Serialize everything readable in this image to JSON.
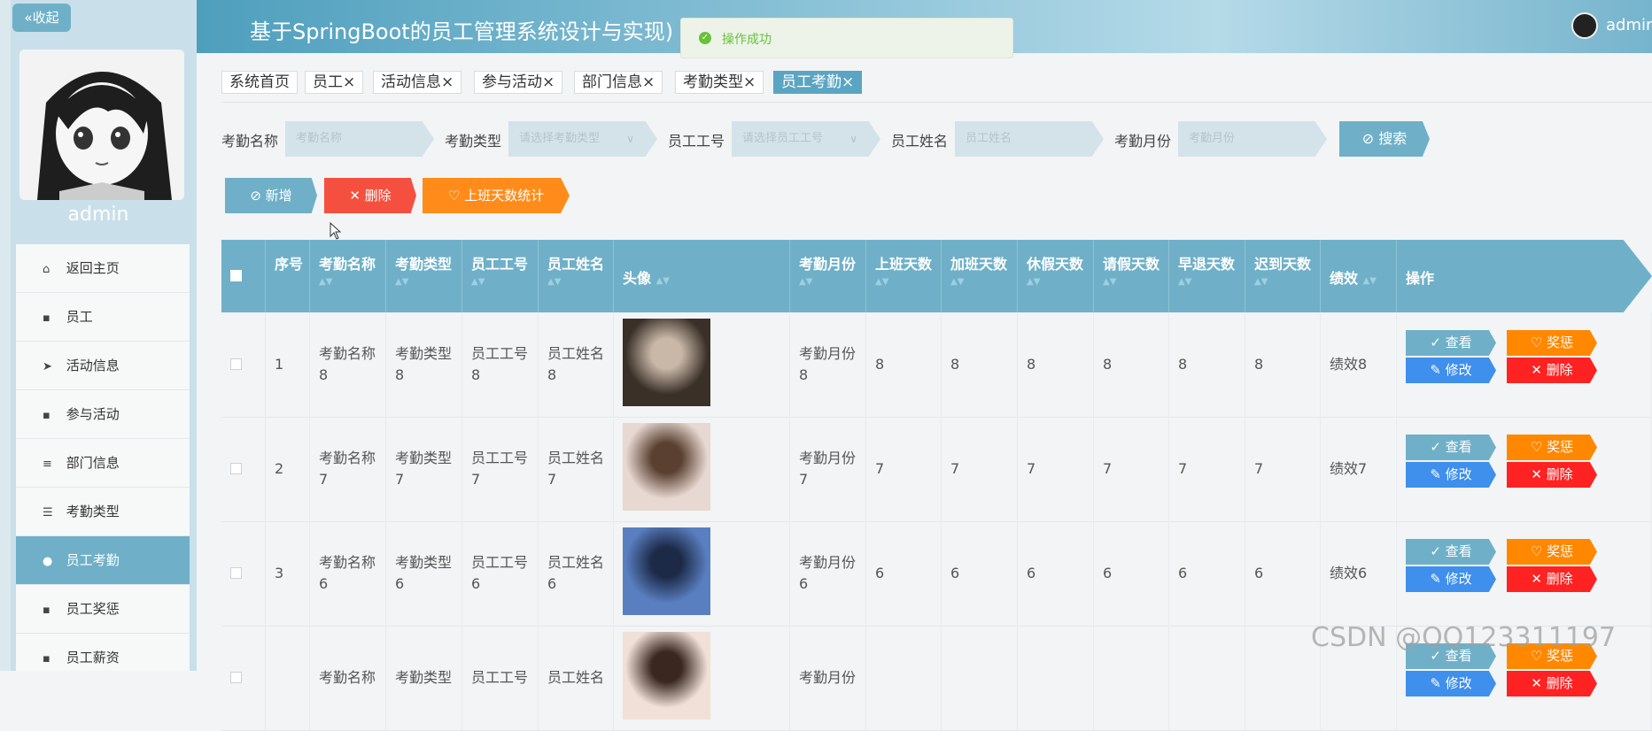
{
  "sidebar": {
    "collapse_label": "«收起",
    "username": "admin",
    "menu": [
      {
        "label": "返回主页",
        "icon": "home-icon",
        "glyph": "⌂",
        "active": false
      },
      {
        "label": "员工",
        "icon": "grid-icon",
        "glyph": "▪",
        "active": false
      },
      {
        "label": "活动信息",
        "icon": "send-icon",
        "glyph": "➤",
        "active": false
      },
      {
        "label": "参与活动",
        "icon": "grid-icon",
        "glyph": "▪",
        "active": false
      },
      {
        "label": "部门信息",
        "icon": "sliders-icon",
        "glyph": "≡",
        "active": false
      },
      {
        "label": "考勤类型",
        "icon": "list-icon",
        "glyph": "☰",
        "active": false
      },
      {
        "label": "员工考勤",
        "icon": "user-icon",
        "glyph": "●",
        "active": true
      },
      {
        "label": "员工奖惩",
        "icon": "grid-icon",
        "glyph": "▪",
        "active": false
      },
      {
        "label": "员工薪资",
        "icon": "grid-icon",
        "glyph": "▪",
        "active": false
      }
    ]
  },
  "header": {
    "title": "基于SpringBoot的员工管理系统设计与实现)",
    "user": "admin"
  },
  "toast": {
    "text": "操作成功",
    "icon": "check-circle-icon"
  },
  "tabs": [
    {
      "label": "系统首页",
      "closable": false
    },
    {
      "label": "员工×",
      "closable": true
    },
    {
      "label": "活动信息×",
      "closable": true
    },
    {
      "label": "参与活动×",
      "closable": true
    },
    {
      "label": "部门信息×",
      "closable": true
    },
    {
      "label": "考勤类型×",
      "closable": true
    },
    {
      "label": "员工考勤×",
      "closable": true,
      "active": true
    }
  ],
  "search": {
    "fields": [
      {
        "label": "考勤名称",
        "placeholder": "考勤名称",
        "dropdown": false
      },
      {
        "label": "考勤类型",
        "placeholder": "请选择考勤类型",
        "dropdown": true
      },
      {
        "label": "员工工号",
        "placeholder": "请选择员工工号",
        "dropdown": true
      },
      {
        "label": "员工姓名",
        "placeholder": "员工姓名",
        "dropdown": false
      },
      {
        "label": "考勤月份",
        "placeholder": "考勤月份",
        "dropdown": false
      }
    ],
    "button": "搜索"
  },
  "actions": {
    "add": "新增",
    "delete": "删除",
    "stats": "上班天数统计"
  },
  "table": {
    "headers": [
      "序号",
      "考勤名称",
      "考勤类型",
      "员工工号",
      "员工姓名",
      "头像",
      "考勤月份",
      "上班天数",
      "加班天数",
      "休假天数",
      "请假天数",
      "早退天数",
      "迟到天数",
      "绩效",
      "操作"
    ],
    "rows": [
      {
        "no": "1",
        "name": "考勤名称8",
        "type": "考勤类型8",
        "emp_no": "员工工号8",
        "emp_name": "员工姓名8",
        "month": "考勤月份8",
        "work": "8",
        "overtime": "8",
        "vacation": "8",
        "leave": "8",
        "early": "8",
        "late": "8",
        "perf": "绩效8"
      },
      {
        "no": "2",
        "name": "考勤名称7",
        "type": "考勤类型7",
        "emp_no": "员工工号7",
        "emp_name": "员工姓名7",
        "month": "考勤月份7",
        "work": "7",
        "overtime": "7",
        "vacation": "7",
        "leave": "7",
        "early": "7",
        "late": "7",
        "perf": "绩效7"
      },
      {
        "no": "3",
        "name": "考勤名称6",
        "type": "考勤类型6",
        "emp_no": "员工工号6",
        "emp_name": "员工姓名6",
        "month": "考勤月份6",
        "work": "6",
        "overtime": "6",
        "vacation": "6",
        "leave": "6",
        "early": "6",
        "late": "6",
        "perf": "绩效6"
      },
      {
        "no": "",
        "name": "考勤名称",
        "type": "考勤类型",
        "emp_no": "员工工号",
        "emp_name": "员工姓名",
        "month": "考勤月份",
        "work": "",
        "overtime": "",
        "vacation": "",
        "leave": "",
        "early": "",
        "late": "",
        "perf": ""
      }
    ],
    "op_labels": {
      "view": "查看",
      "reward": "奖惩",
      "edit": "修改",
      "delete": "删除"
    }
  },
  "watermark": "CSDN @QQ123311197",
  "colors": {
    "primary": "#6fb0c8",
    "orange": "#ff8800",
    "red": "#ff2222",
    "blue": "#3f8fec",
    "success": "#67c23a"
  }
}
